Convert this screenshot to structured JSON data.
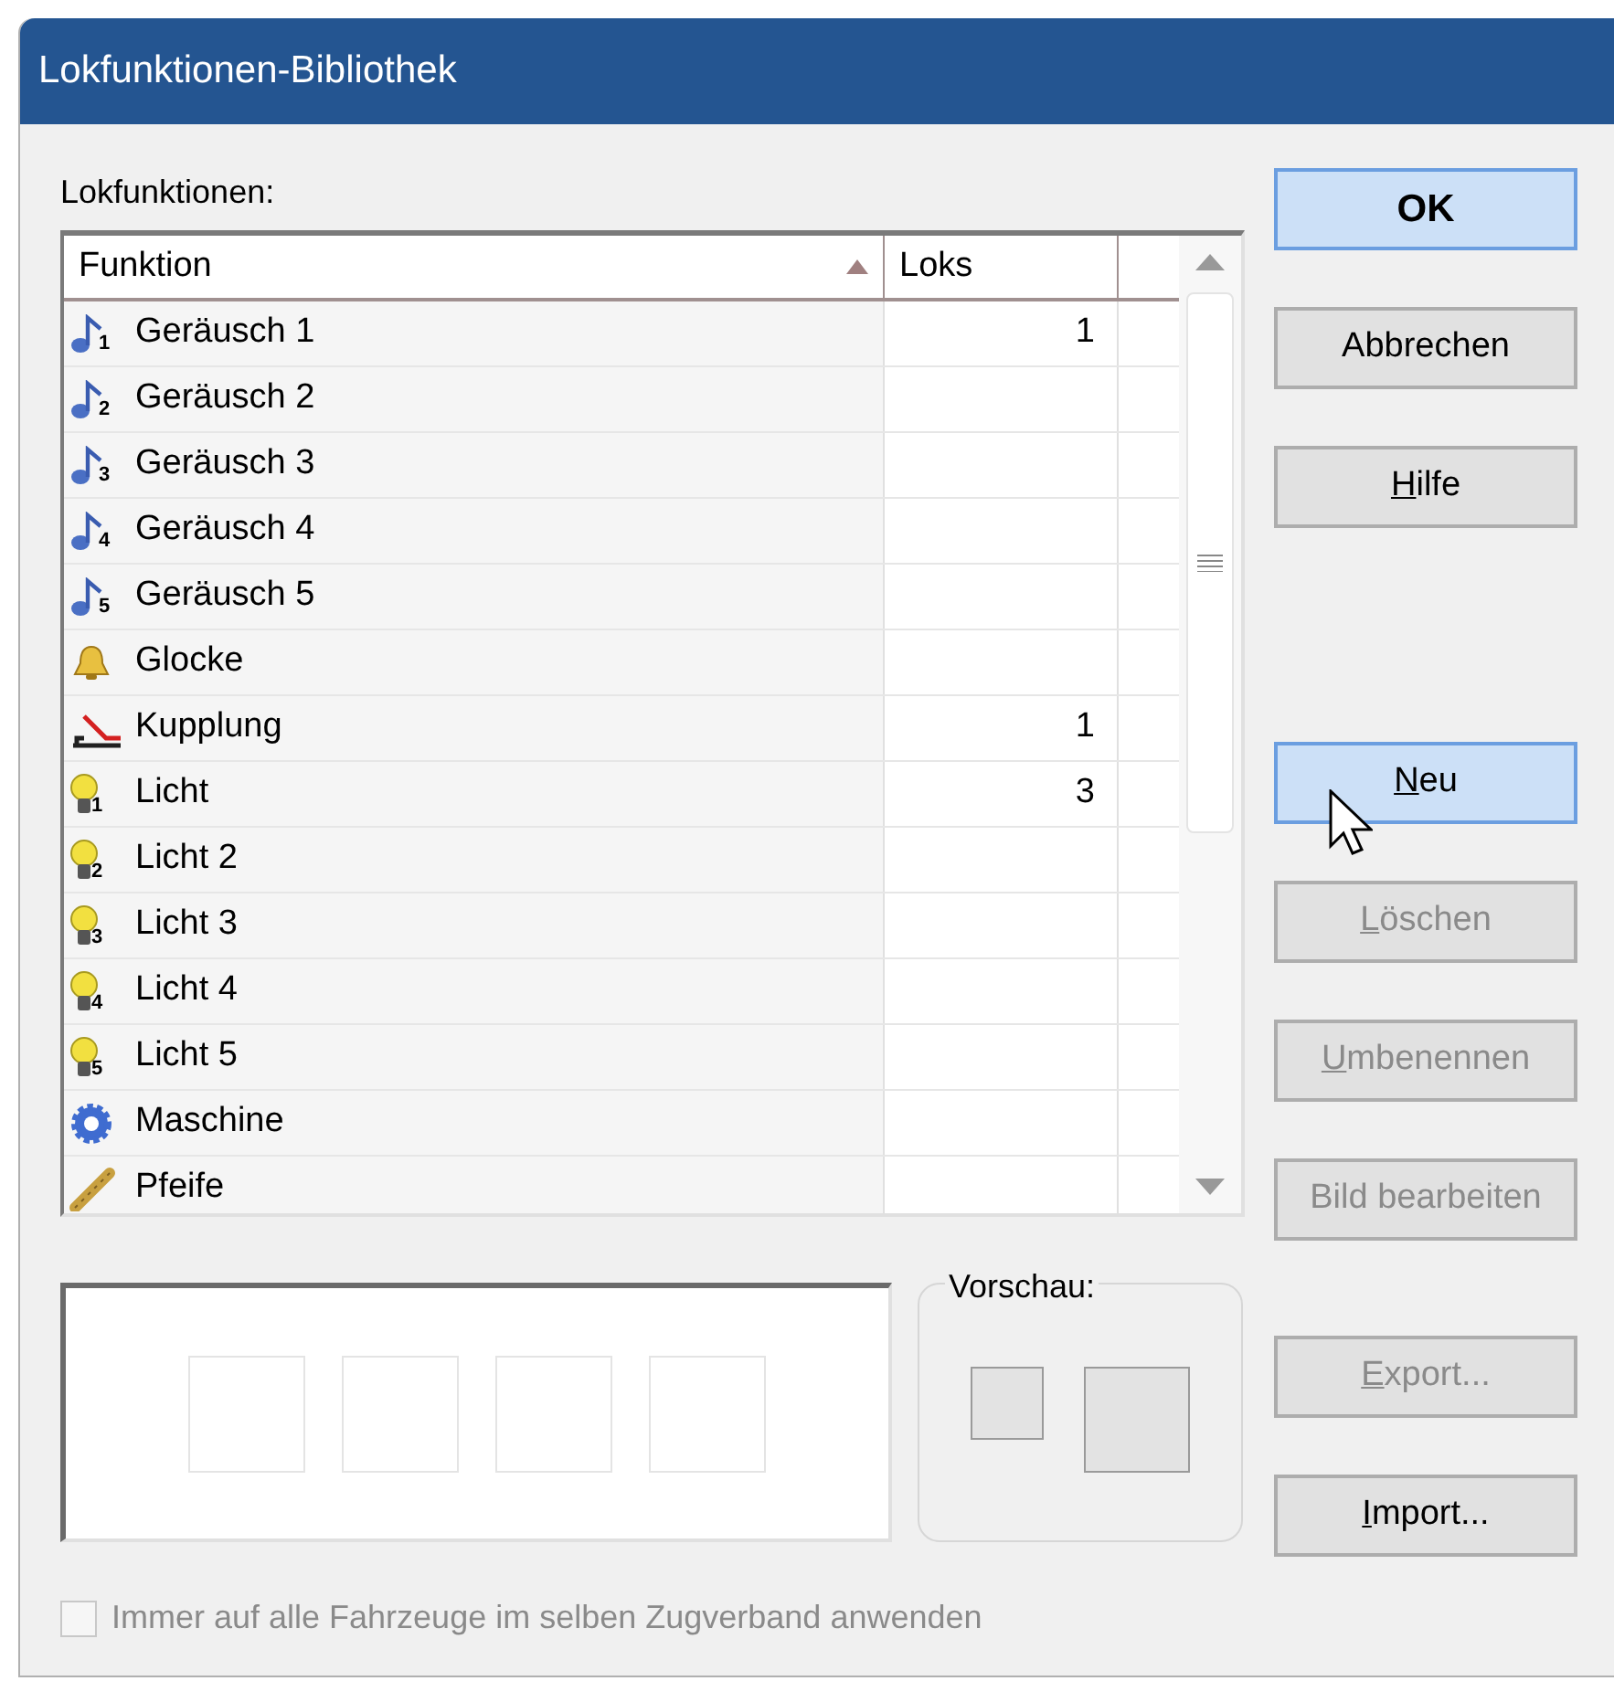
{
  "window": {
    "title": "Lokfunktionen-Bibliothek"
  },
  "list_label": "Lokfunktionen:",
  "table": {
    "columns": [
      {
        "label": "Funktion",
        "sorted": true
      },
      {
        "label": "Loks",
        "sorted": false
      }
    ],
    "rows": [
      {
        "kind": "sound",
        "badge": "1",
        "name": "Geräusch 1",
        "loks": "1"
      },
      {
        "kind": "sound",
        "badge": "2",
        "name": "Geräusch 2"
      },
      {
        "kind": "sound",
        "badge": "3",
        "name": "Geräusch 3"
      },
      {
        "kind": "sound",
        "badge": "4",
        "name": "Geräusch 4"
      },
      {
        "kind": "sound",
        "badge": "5",
        "name": "Geräusch 5"
      },
      {
        "kind": "bell",
        "name": "Glocke"
      },
      {
        "kind": "coupling",
        "name": "Kupplung",
        "loks": "1"
      },
      {
        "kind": "light",
        "badge": "1",
        "name": "Licht",
        "loks": "3"
      },
      {
        "kind": "light",
        "badge": "2",
        "name": "Licht 2"
      },
      {
        "kind": "light",
        "badge": "3",
        "name": "Licht 3"
      },
      {
        "kind": "light",
        "badge": "4",
        "name": "Licht 4"
      },
      {
        "kind": "light",
        "badge": "5",
        "name": "Licht 5"
      },
      {
        "kind": "engine",
        "name": "Maschine"
      },
      {
        "kind": "whistle",
        "name": "Pfeife"
      }
    ]
  },
  "buttons": [
    {
      "label": "OK",
      "default": true,
      "hovered": false,
      "disabled": false,
      "access_key": false
    },
    {
      "label": "Abbrechen",
      "default": false,
      "hovered": false,
      "disabled": false,
      "access_key": false
    },
    {
      "label": "Hilfe",
      "default": false,
      "hovered": false,
      "disabled": false,
      "access_key": true
    },
    {
      "label": "Neu",
      "default": false,
      "hovered": true,
      "disabled": false,
      "access_key": true
    },
    {
      "label": "Löschen",
      "default": false,
      "hovered": false,
      "disabled": true,
      "access_key": true
    },
    {
      "label": "Umbenennen",
      "default": false,
      "hovered": false,
      "disabled": true,
      "access_key": true
    },
    {
      "label": "Bild bearbeiten",
      "default": false,
      "hovered": false,
      "disabled": true,
      "access_key": false
    }
  ],
  "preview": {
    "title": "Vorschau:"
  },
  "bottom_buttons": [
    {
      "label": "Export...",
      "default": false,
      "hovered": false,
      "disabled": true,
      "access_key": true
    },
    {
      "label": "Import...",
      "default": false,
      "hovered": false,
      "disabled": false,
      "access_key": true
    }
  ],
  "checkbox": {
    "label": "Immer auf alle Fahrzeuge im selben Zugverband anwenden",
    "checked": false,
    "disabled": true
  }
}
